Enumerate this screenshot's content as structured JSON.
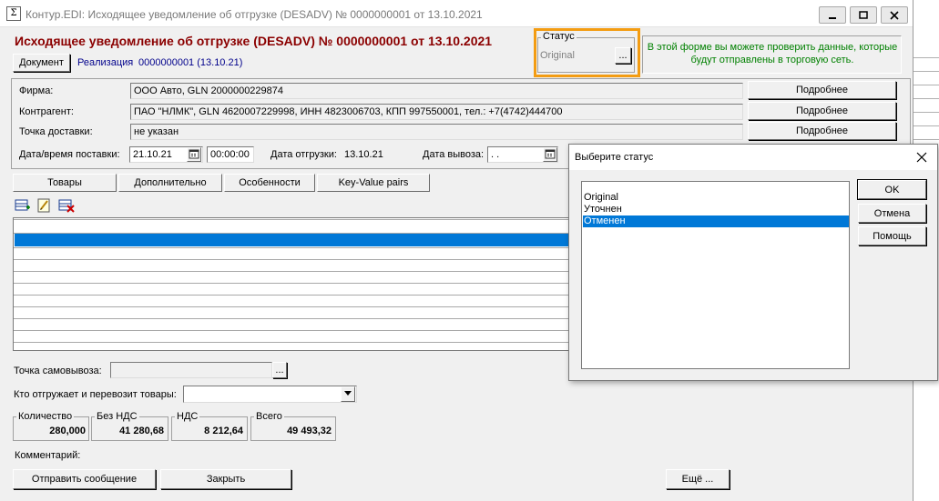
{
  "window": {
    "title": "Контур.EDI: Исходящее уведомление об отгрузке (DESADV) № 0000000001 от 13.10.2021",
    "app_icon": "Σ̄"
  },
  "header": {
    "doc_title": "Исходящее уведомление об отгрузке (DESADV) № 0000000001 от 13.10.2021",
    "document_button": "Документ",
    "link_prefix": "Реализация",
    "link_text": "0000000001 (13.10.21)"
  },
  "status": {
    "legend": "Статус",
    "value": "Original",
    "button": "...",
    "highlight_color": "#f39c12"
  },
  "info": {
    "text": "В этой форме вы можете проверить данные, которые будут отправлены в торговую сеть.",
    "color": "#008000"
  },
  "fields": {
    "firm_label": "Фирма:",
    "firm_value": "ООО Авто, GLN 2000000229874",
    "contractor_label": "Контрагент:",
    "contractor_value": "ПАО \"НЛМК\", GLN 4620007229998, ИНН 4823006703, КПП 997550001, тел.: +7(4742)444700",
    "delivery_point_label": "Точка доставки:",
    "delivery_point_value": "не указан",
    "more_button": "Подробнее",
    "delivery_dt_label": "Дата/время поставки:",
    "delivery_date": "21.10.21",
    "delivery_time": "00:00:00",
    "ship_date_label": "Дата отгрузки:",
    "ship_date_value": "13.10.21",
    "export_date_label": "Дата вывоза:",
    "export_date_value": " .  ."
  },
  "tabs": [
    {
      "label": "Товары"
    },
    {
      "label": "Дополнительно"
    },
    {
      "label": "Особенности"
    },
    {
      "label": "Key-Value pairs"
    }
  ],
  "pickup": {
    "label": "Точка самовывоза:",
    "value": "",
    "button": "..."
  },
  "carrier": {
    "label": "Кто отгружает и перевозит товары:",
    "value": ""
  },
  "totals": {
    "qty_label": "Количество",
    "qty_value": "280,000",
    "no_vat_label": "Без НДС",
    "no_vat_value": "41 280,68",
    "vat_label": "НДС",
    "vat_value": "8 212,64",
    "total_label": "Всего",
    "total_value": "49 493,32"
  },
  "comment_label": "Комментарий:",
  "footer": {
    "send": "Отправить сообщение",
    "close": "Закрыть",
    "more": "Ещё ..."
  },
  "dialog": {
    "title": "Выберите статус",
    "items": [
      "Original",
      "Уточнен",
      "Отменен"
    ],
    "selected_index": 2,
    "ok": "OK",
    "cancel": "Отмена",
    "help": "Помощь"
  },
  "colors": {
    "title_red": "#8b0000",
    "link_blue": "#00008b",
    "selection": "#0078d7"
  }
}
